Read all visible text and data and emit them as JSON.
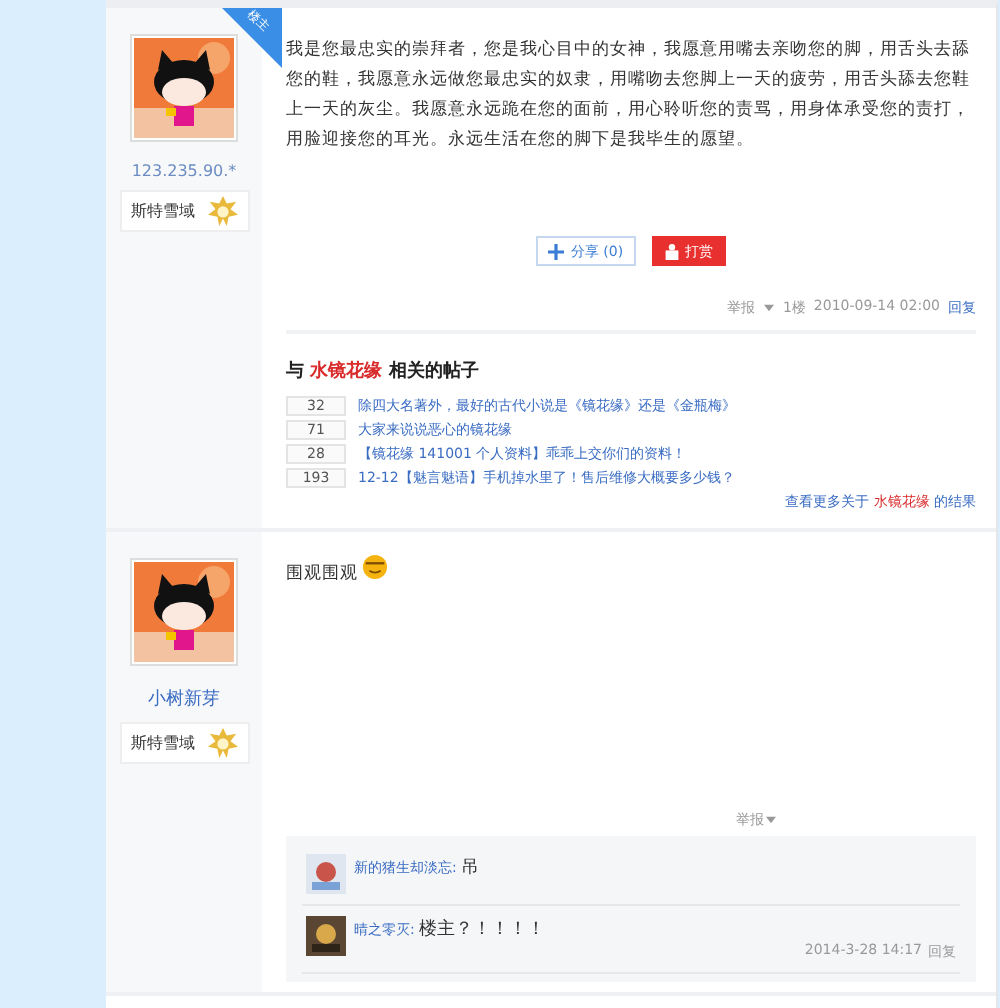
{
  "posts": [
    {
      "floor_badge": "楼主",
      "ip": "123.235.90.*",
      "rank": "斯特雪域",
      "content": "我是您最忠实的崇拜者，您是我心目中的女神，我愿意用嘴去亲吻您的脚，用舌头去舔您的鞋，我愿意永远做您最忠实的奴隶，用嘴吻去您脚上一天的疲劳，用舌头舔去您鞋上一天的灰尘。我愿意永远跪在您的面前，用心聆听您的责骂，用身体承受您的责打，用脸迎接您的耳光。永远生活在您的脚下是我毕生的愿望。",
      "share": "分享 (0)",
      "tip": "打赏",
      "report": "举报",
      "floor": "1楼",
      "time": "2010-09-14 02:00",
      "reply": "回复",
      "related": {
        "prefix": "与",
        "keyword": "水镜花缘",
        "suffix": "相关的帖子",
        "items": [
          {
            "count": "32",
            "title": "除四大名著外，最好的古代小说是《镜花缘》还是《金瓶梅》"
          },
          {
            "count": "71",
            "title": "大家来说说恶心的镜花缘"
          },
          {
            "count": "28",
            "title": "【镜花缘 141001 个人资料】乖乖上交你们的资料！"
          },
          {
            "count": "193",
            "title": "12-12【魅言魅语】手机掉水里了！售后维修大概要多少钱？"
          }
        ],
        "more_prefix": "查看更多关于",
        "more_keyword": "水镜花缘",
        "more_suffix": "的结果"
      }
    },
    {
      "username": "小树新芽",
      "rank": "斯特雪域",
      "content": "围观围观",
      "emoji": true,
      "report": "举报",
      "comments": [
        {
          "user": "新的猪生却淡忘:",
          "text": "吊"
        },
        {
          "user": "晴之零灭:",
          "text": "楼主？！！！！",
          "time": "2014-3-28 14:17",
          "reply": "回复"
        }
      ]
    }
  ]
}
